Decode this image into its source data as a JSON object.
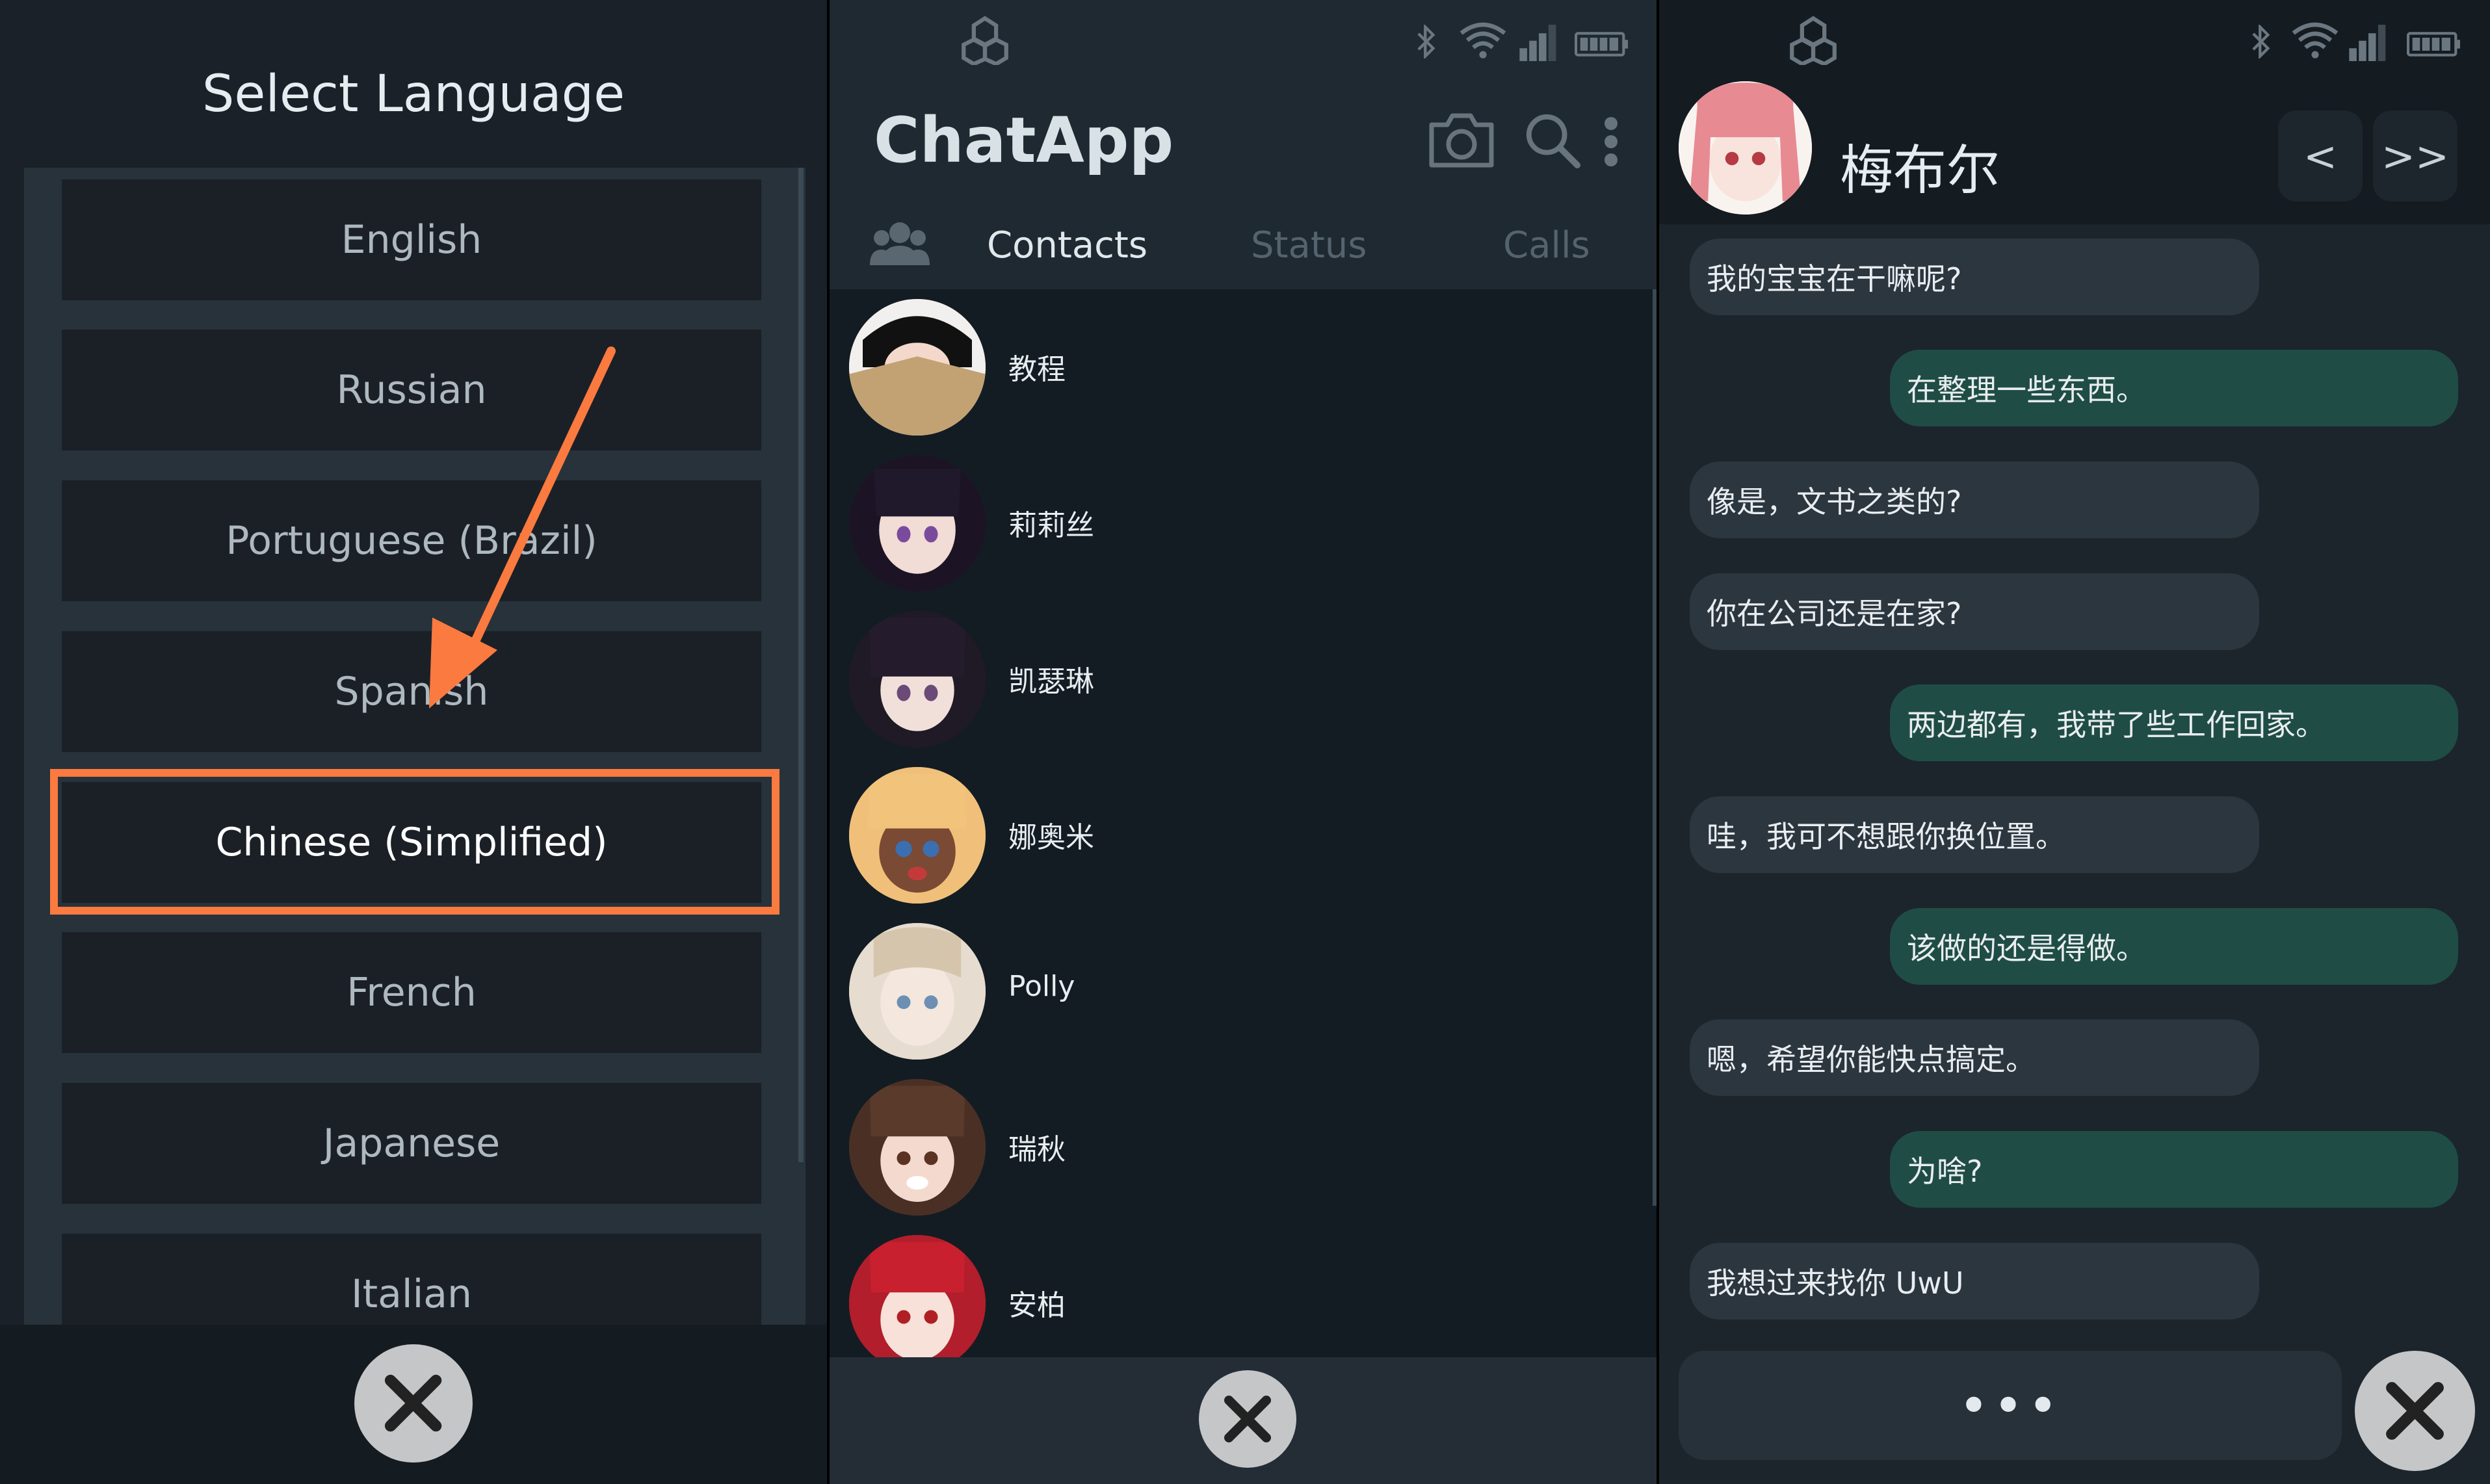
{
  "language_panel": {
    "title": "Select Language",
    "languages": [
      {
        "label": "English",
        "selected": false
      },
      {
        "label": "Russian",
        "selected": false
      },
      {
        "label": "Portuguese (Brazil)",
        "selected": false
      },
      {
        "label": "Spanish",
        "selected": false
      },
      {
        "label": "Chinese (Simplified)",
        "selected": true
      },
      {
        "label": "French",
        "selected": false
      },
      {
        "label": "Japanese",
        "selected": false
      },
      {
        "label": "Italian",
        "selected": false
      }
    ],
    "highlight_color": "#fb7a3f"
  },
  "contacts_panel": {
    "app_name": "ChatApp",
    "tabs": [
      {
        "label": "Contacts",
        "active": true
      },
      {
        "label": "Status",
        "active": false
      },
      {
        "label": "Calls",
        "active": false
      }
    ],
    "contacts": [
      {
        "name": "教程"
      },
      {
        "name": "莉莉丝"
      },
      {
        "name": "凯瑟琳"
      },
      {
        "name": "娜奥米"
      },
      {
        "name": "Polly"
      },
      {
        "name": "瑞秋"
      },
      {
        "name": "安柏"
      }
    ]
  },
  "chat_panel": {
    "contact_name": "梅布尔",
    "nav_back_label": "<",
    "nav_skip_label": ">>",
    "messages": [
      {
        "from": "them",
        "text": "我的宝宝在干嘛呢?"
      },
      {
        "from": "me",
        "text": "在整理一些东西。"
      },
      {
        "from": "them",
        "text": "像是，文书之类的?"
      },
      {
        "from": "them",
        "text": "你在公司还是在家?"
      },
      {
        "from": "me",
        "text": "两边都有，我带了些工作回家。"
      },
      {
        "from": "them",
        "text": "哇，我可不想跟你换位置。"
      },
      {
        "from": "me",
        "text": "该做的还是得做。"
      },
      {
        "from": "them",
        "text": "嗯，希望你能快点搞定。"
      },
      {
        "from": "me",
        "text": "为啥?"
      },
      {
        "from": "them",
        "text": "我想过来找你 UwU"
      }
    ],
    "input_placeholder": "•••"
  }
}
